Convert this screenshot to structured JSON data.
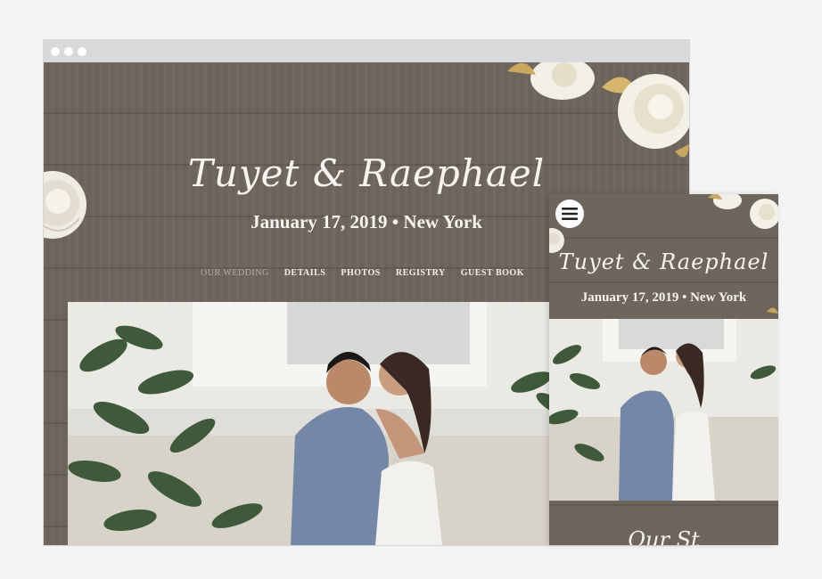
{
  "site": {
    "couple_names": "Tuyet & Raephael",
    "date_location": "January 17, 2019 • New York",
    "nav": [
      "OUR WEDDING",
      "DETAILS",
      "PHOTOS",
      "REGISTRY",
      "GUEST BOOK"
    ],
    "active_nav": "OUR WEDDING"
  },
  "mobile": {
    "couple_names": "Tuyet & Raephael",
    "date_location": "January 17, 2019 • New York",
    "menu_icon": "hamburger-menu-icon",
    "next_heading_partial": "Our St"
  },
  "colors": {
    "wood": "#6e655d",
    "text": "#f7f3ee",
    "nav_active": "#b7ada3"
  }
}
